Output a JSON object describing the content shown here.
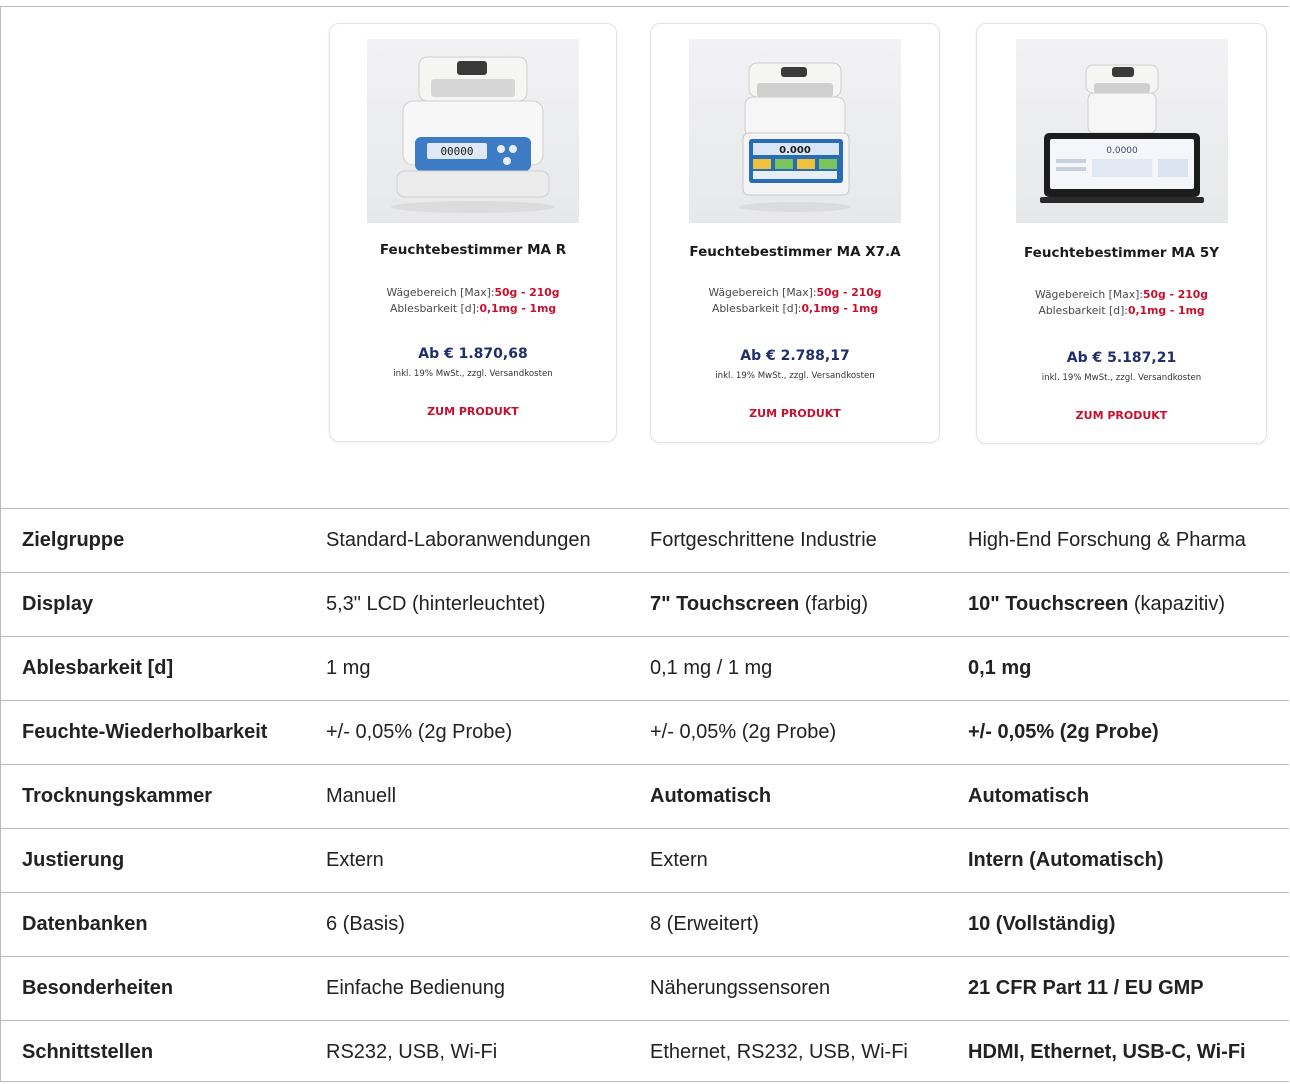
{
  "products": [
    {
      "title": "Feuchtebestimmer MA R",
      "spec_weigh_label": "Wägebereich [Max]:",
      "spec_weigh_value": "50g - 210g",
      "spec_read_label": "Ablesbarkeit [d]:",
      "spec_read_value": "0,1mg - 1mg",
      "price": "Ab € 1.870,68",
      "tax_note": "inkl. 19% MwSt., zzgl. Versandkosten",
      "cta": "ZUM PRODUKT",
      "display_readout": "00000"
    },
    {
      "title": "Feuchtebestimmer MA X7.A",
      "spec_weigh_label": "Wägebereich [Max]:",
      "spec_weigh_value": "50g - 210g",
      "spec_read_label": "Ablesbarkeit [d]:",
      "spec_read_value": "0,1mg - 1mg",
      "price": "Ab € 2.788,17",
      "tax_note": "inkl. 19% MwSt., zzgl. Versandkosten",
      "cta": "ZUM PRODUKT",
      "display_readout": "0.000"
    },
    {
      "title": "Feuchtebestimmer MA 5Y",
      "spec_weigh_label": "Wägebereich [Max]:",
      "spec_weigh_value": "50g - 210g",
      "spec_read_label": "Ablesbarkeit [d]:",
      "spec_read_value": "0,1mg - 1mg",
      "price": "Ab € 5.187,21",
      "tax_note": "inkl. 19% MwSt., zzgl. Versandkosten",
      "cta": "ZUM PRODUKT",
      "display_readout": "0.0000"
    }
  ],
  "colors": {
    "accent_red": "#c8102e",
    "price_navy": "#1f2f6b",
    "border": "#bdbdbd"
  },
  "table": {
    "rows": [
      {
        "label": "Zielgruppe",
        "cells": [
          [
            {
              "t": "Standard-Laboranwendungen",
              "b": false
            }
          ],
          [
            {
              "t": "Fortgeschrittene Industrie",
              "b": false
            }
          ],
          [
            {
              "t": "High-End Forschung & Pharma",
              "b": false
            }
          ]
        ]
      },
      {
        "label": "Display",
        "cells": [
          [
            {
              "t": "5,3\" LCD (hinterleuchtet)",
              "b": false
            }
          ],
          [
            {
              "t": "7\" Touchscreen",
              "b": true
            },
            {
              "t": " (farbig)",
              "b": false
            }
          ],
          [
            {
              "t": "10\" Touchscreen",
              "b": true
            },
            {
              "t": " (kapazitiv)",
              "b": false
            }
          ]
        ]
      },
      {
        "label": "Ablesbarkeit [d]",
        "cells": [
          [
            {
              "t": "1 mg",
              "b": false
            }
          ],
          [
            {
              "t": "0,1 mg / 1 mg",
              "b": false
            }
          ],
          [
            {
              "t": "0,1 mg",
              "b": true
            }
          ]
        ]
      },
      {
        "label": "Feuchte-Wiederholbarkeit",
        "cells": [
          [
            {
              "t": "+/- 0,05% (2g Probe)",
              "b": false
            }
          ],
          [
            {
              "t": "+/- 0,05% (2g Probe)",
              "b": false
            }
          ],
          [
            {
              "t": "+/- 0,05% (2g Probe)",
              "b": true
            }
          ]
        ]
      },
      {
        "label": "Trocknungskammer",
        "cells": [
          [
            {
              "t": "Manuell",
              "b": false
            }
          ],
          [
            {
              "t": "Automatisch",
              "b": true
            }
          ],
          [
            {
              "t": "Automatisch",
              "b": true
            }
          ]
        ]
      },
      {
        "label": "Justierung",
        "cells": [
          [
            {
              "t": "Extern",
              "b": false
            }
          ],
          [
            {
              "t": "Extern",
              "b": false
            }
          ],
          [
            {
              "t": "Intern (Automatisch)",
              "b": true
            }
          ]
        ]
      },
      {
        "label": "Datenbanken",
        "cells": [
          [
            {
              "t": "6 (Basis)",
              "b": false
            }
          ],
          [
            {
              "t": "8 (Erweitert)",
              "b": false
            }
          ],
          [
            {
              "t": "10 (Vollständig)",
              "b": true
            }
          ]
        ]
      },
      {
        "label": "Besonderheiten",
        "cells": [
          [
            {
              "t": "Einfache Bedienung",
              "b": false
            }
          ],
          [
            {
              "t": "Näherungssensoren",
              "b": false
            }
          ],
          [
            {
              "t": "21 CFR Part 11 / EU GMP",
              "b": true
            }
          ]
        ]
      },
      {
        "label": "Schnittstellen",
        "cells": [
          [
            {
              "t": "RS232, USB, Wi-Fi",
              "b": false
            }
          ],
          [
            {
              "t": "Ethernet, RS232, USB, Wi-Fi",
              "b": false
            }
          ],
          [
            {
              "t": "HDMI, Ethernet, USB-C, Wi-Fi",
              "b": true
            }
          ]
        ]
      }
    ]
  }
}
